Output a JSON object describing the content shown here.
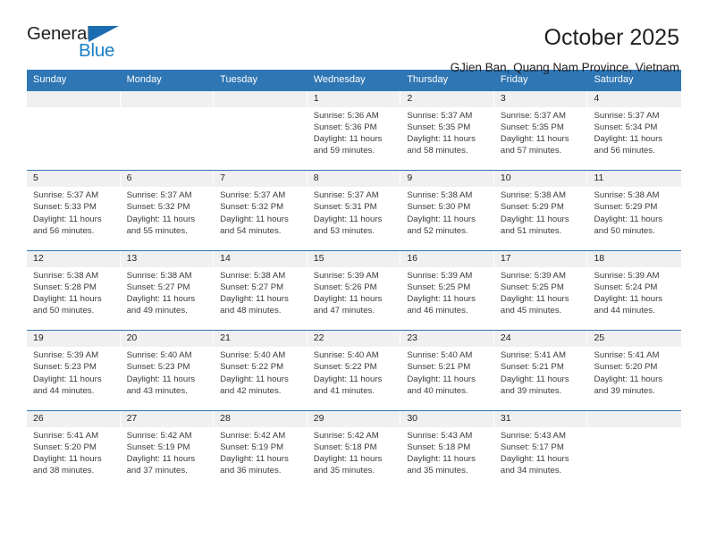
{
  "brand": {
    "name_part1": "General",
    "name_part2": "Blue",
    "triangle_icon": "brand-triangle-icon",
    "color_dark": "#231f20",
    "color_blue": "#1b7fc4"
  },
  "header": {
    "month_title": "October 2025",
    "location": "GJien Ban, Quang Nam Province, Vietnam"
  },
  "calendar": {
    "accent_color": "#2f76b4",
    "daynum_band_color": "#f0f0f0",
    "labels": {
      "sunrise_prefix": "Sunrise:",
      "sunset_prefix": "Sunset:",
      "daylight_prefix": "Daylight:"
    },
    "day_headers": [
      "Sunday",
      "Monday",
      "Tuesday",
      "Wednesday",
      "Thursday",
      "Friday",
      "Saturday"
    ],
    "weeks": [
      [
        {
          "day": "",
          "empty": true
        },
        {
          "day": "",
          "empty": true
        },
        {
          "day": "",
          "empty": true
        },
        {
          "day": "1",
          "sunrise": "Sunrise: 5:36 AM",
          "sunset": "Sunset: 5:36 PM",
          "daylight_line1": "Daylight: 11 hours",
          "daylight_line2": "and 59 minutes."
        },
        {
          "day": "2",
          "sunrise": "Sunrise: 5:37 AM",
          "sunset": "Sunset: 5:35 PM",
          "daylight_line1": "Daylight: 11 hours",
          "daylight_line2": "and 58 minutes."
        },
        {
          "day": "3",
          "sunrise": "Sunrise: 5:37 AM",
          "sunset": "Sunset: 5:35 PM",
          "daylight_line1": "Daylight: 11 hours",
          "daylight_line2": "and 57 minutes."
        },
        {
          "day": "4",
          "sunrise": "Sunrise: 5:37 AM",
          "sunset": "Sunset: 5:34 PM",
          "daylight_line1": "Daylight: 11 hours",
          "daylight_line2": "and 56 minutes."
        }
      ],
      [
        {
          "day": "5",
          "sunrise": "Sunrise: 5:37 AM",
          "sunset": "Sunset: 5:33 PM",
          "daylight_line1": "Daylight: 11 hours",
          "daylight_line2": "and 56 minutes."
        },
        {
          "day": "6",
          "sunrise": "Sunrise: 5:37 AM",
          "sunset": "Sunset: 5:32 PM",
          "daylight_line1": "Daylight: 11 hours",
          "daylight_line2": "and 55 minutes."
        },
        {
          "day": "7",
          "sunrise": "Sunrise: 5:37 AM",
          "sunset": "Sunset: 5:32 PM",
          "daylight_line1": "Daylight: 11 hours",
          "daylight_line2": "and 54 minutes."
        },
        {
          "day": "8",
          "sunrise": "Sunrise: 5:37 AM",
          "sunset": "Sunset: 5:31 PM",
          "daylight_line1": "Daylight: 11 hours",
          "daylight_line2": "and 53 minutes."
        },
        {
          "day": "9",
          "sunrise": "Sunrise: 5:38 AM",
          "sunset": "Sunset: 5:30 PM",
          "daylight_line1": "Daylight: 11 hours",
          "daylight_line2": "and 52 minutes."
        },
        {
          "day": "10",
          "sunrise": "Sunrise: 5:38 AM",
          "sunset": "Sunset: 5:29 PM",
          "daylight_line1": "Daylight: 11 hours",
          "daylight_line2": "and 51 minutes."
        },
        {
          "day": "11",
          "sunrise": "Sunrise: 5:38 AM",
          "sunset": "Sunset: 5:29 PM",
          "daylight_line1": "Daylight: 11 hours",
          "daylight_line2": "and 50 minutes."
        }
      ],
      [
        {
          "day": "12",
          "sunrise": "Sunrise: 5:38 AM",
          "sunset": "Sunset: 5:28 PM",
          "daylight_line1": "Daylight: 11 hours",
          "daylight_line2": "and 50 minutes."
        },
        {
          "day": "13",
          "sunrise": "Sunrise: 5:38 AM",
          "sunset": "Sunset: 5:27 PM",
          "daylight_line1": "Daylight: 11 hours",
          "daylight_line2": "and 49 minutes."
        },
        {
          "day": "14",
          "sunrise": "Sunrise: 5:38 AM",
          "sunset": "Sunset: 5:27 PM",
          "daylight_line1": "Daylight: 11 hours",
          "daylight_line2": "and 48 minutes."
        },
        {
          "day": "15",
          "sunrise": "Sunrise: 5:39 AM",
          "sunset": "Sunset: 5:26 PM",
          "daylight_line1": "Daylight: 11 hours",
          "daylight_line2": "and 47 minutes."
        },
        {
          "day": "16",
          "sunrise": "Sunrise: 5:39 AM",
          "sunset": "Sunset: 5:25 PM",
          "daylight_line1": "Daylight: 11 hours",
          "daylight_line2": "and 46 minutes."
        },
        {
          "day": "17",
          "sunrise": "Sunrise: 5:39 AM",
          "sunset": "Sunset: 5:25 PM",
          "daylight_line1": "Daylight: 11 hours",
          "daylight_line2": "and 45 minutes."
        },
        {
          "day": "18",
          "sunrise": "Sunrise: 5:39 AM",
          "sunset": "Sunset: 5:24 PM",
          "daylight_line1": "Daylight: 11 hours",
          "daylight_line2": "and 44 minutes."
        }
      ],
      [
        {
          "day": "19",
          "sunrise": "Sunrise: 5:39 AM",
          "sunset": "Sunset: 5:23 PM",
          "daylight_line1": "Daylight: 11 hours",
          "daylight_line2": "and 44 minutes."
        },
        {
          "day": "20",
          "sunrise": "Sunrise: 5:40 AM",
          "sunset": "Sunset: 5:23 PM",
          "daylight_line1": "Daylight: 11 hours",
          "daylight_line2": "and 43 minutes."
        },
        {
          "day": "21",
          "sunrise": "Sunrise: 5:40 AM",
          "sunset": "Sunset: 5:22 PM",
          "daylight_line1": "Daylight: 11 hours",
          "daylight_line2": "and 42 minutes."
        },
        {
          "day": "22",
          "sunrise": "Sunrise: 5:40 AM",
          "sunset": "Sunset: 5:22 PM",
          "daylight_line1": "Daylight: 11 hours",
          "daylight_line2": "and 41 minutes."
        },
        {
          "day": "23",
          "sunrise": "Sunrise: 5:40 AM",
          "sunset": "Sunset: 5:21 PM",
          "daylight_line1": "Daylight: 11 hours",
          "daylight_line2": "and 40 minutes."
        },
        {
          "day": "24",
          "sunrise": "Sunrise: 5:41 AM",
          "sunset": "Sunset: 5:21 PM",
          "daylight_line1": "Daylight: 11 hours",
          "daylight_line2": "and 39 minutes."
        },
        {
          "day": "25",
          "sunrise": "Sunrise: 5:41 AM",
          "sunset": "Sunset: 5:20 PM",
          "daylight_line1": "Daylight: 11 hours",
          "daylight_line2": "and 39 minutes."
        }
      ],
      [
        {
          "day": "26",
          "sunrise": "Sunrise: 5:41 AM",
          "sunset": "Sunset: 5:20 PM",
          "daylight_line1": "Daylight: 11 hours",
          "daylight_line2": "and 38 minutes."
        },
        {
          "day": "27",
          "sunrise": "Sunrise: 5:42 AM",
          "sunset": "Sunset: 5:19 PM",
          "daylight_line1": "Daylight: 11 hours",
          "daylight_line2": "and 37 minutes."
        },
        {
          "day": "28",
          "sunrise": "Sunrise: 5:42 AM",
          "sunset": "Sunset: 5:19 PM",
          "daylight_line1": "Daylight: 11 hours",
          "daylight_line2": "and 36 minutes."
        },
        {
          "day": "29",
          "sunrise": "Sunrise: 5:42 AM",
          "sunset": "Sunset: 5:18 PM",
          "daylight_line1": "Daylight: 11 hours",
          "daylight_line2": "and 35 minutes."
        },
        {
          "day": "30",
          "sunrise": "Sunrise: 5:43 AM",
          "sunset": "Sunset: 5:18 PM",
          "daylight_line1": "Daylight: 11 hours",
          "daylight_line2": "and 35 minutes."
        },
        {
          "day": "31",
          "sunrise": "Sunrise: 5:43 AM",
          "sunset": "Sunset: 5:17 PM",
          "daylight_line1": "Daylight: 11 hours",
          "daylight_line2": "and 34 minutes."
        },
        {
          "day": "",
          "empty": true
        }
      ]
    ]
  }
}
